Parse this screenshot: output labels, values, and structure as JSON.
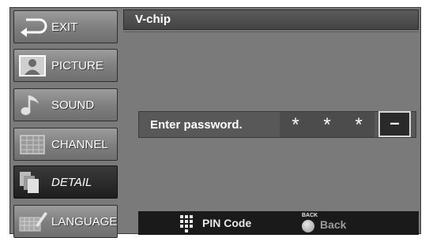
{
  "menu": {
    "items": [
      {
        "label": "EXIT",
        "icon": "exit-return-arrow-icon",
        "selected": false
      },
      {
        "label": "PICTURE",
        "icon": "picture-portrait-icon",
        "selected": false
      },
      {
        "label": "SOUND",
        "icon": "sound-note-icon",
        "selected": false
      },
      {
        "label": "CHANNEL",
        "icon": "channel-grid-icon",
        "selected": false
      },
      {
        "label": "DETAIL",
        "icon": "detail-pages-icon",
        "selected": true
      },
      {
        "label": "LANGUAGE",
        "icon": "language-keyboard-icon",
        "selected": false
      }
    ]
  },
  "panel": {
    "title": "V-chip",
    "password": {
      "label": "Enter password.",
      "digits": [
        "*",
        "*",
        "*"
      ],
      "cursor": "–"
    }
  },
  "footer": {
    "pin_label": "PIN Code",
    "back_caption": "BACK",
    "back_label": "Back"
  },
  "colors": {
    "background": "#7a7a7a",
    "selected_item": "#1e1e1e",
    "footer": "#1a1a1a"
  }
}
